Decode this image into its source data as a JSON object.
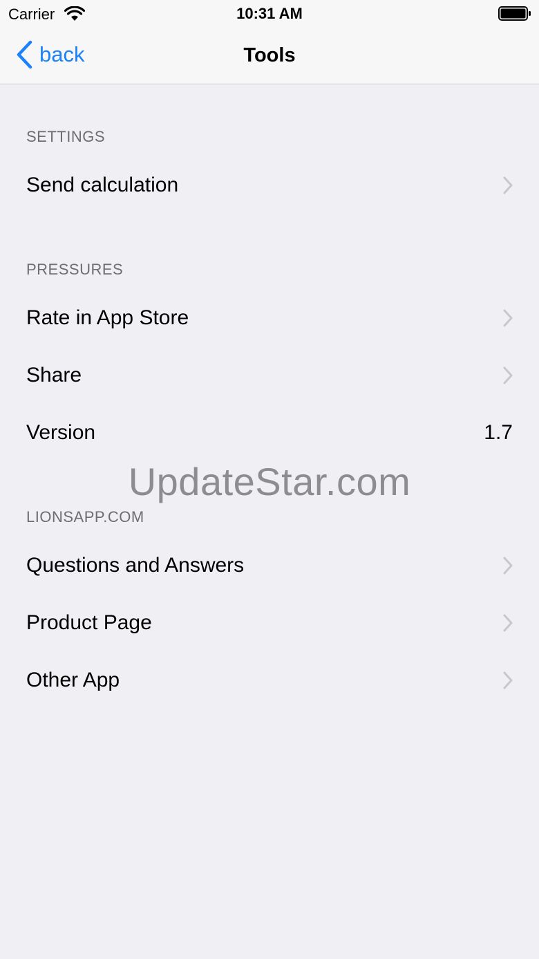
{
  "status_bar": {
    "carrier": "Carrier",
    "time": "10:31 AM",
    "wifi_icon": "wifi-icon",
    "battery_icon": "battery-icon"
  },
  "nav": {
    "back_label": "back",
    "title": "Tools",
    "accent_color": "#1a82fb"
  },
  "sections": [
    {
      "header": "SETTINGS",
      "rows": [
        {
          "label": "Send calculation",
          "icon": "chevron-right-icon"
        }
      ]
    },
    {
      "header": "PRESSURES",
      "rows": [
        {
          "label": "Rate in App Store",
          "icon": "chevron-right-icon"
        },
        {
          "label": "Share",
          "icon": "chevron-right-icon"
        },
        {
          "label": "Version",
          "value": "1.7"
        }
      ]
    },
    {
      "header": "LIONSAPP.COM",
      "rows": [
        {
          "label": "Questions and Answers",
          "icon": "chevron-right-icon"
        },
        {
          "label": "Product Page",
          "icon": "chevron-right-icon"
        },
        {
          "label": "Other App",
          "icon": "chevron-right-icon"
        }
      ]
    }
  ],
  "watermark": "UpdateStar.com"
}
